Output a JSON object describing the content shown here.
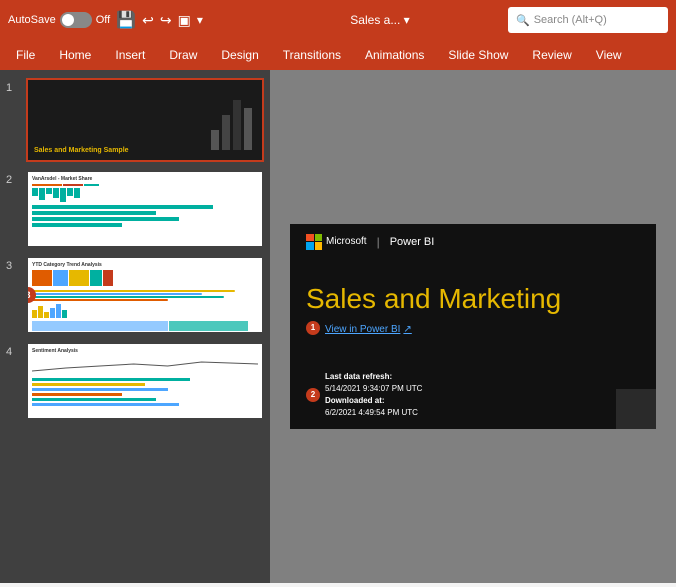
{
  "titlebar": {
    "autosave_label": "AutoSave",
    "autosave_state": "Off",
    "filename": "Sales a...",
    "search_placeholder": "Search (Alt+Q)"
  },
  "tabs": [
    {
      "label": "File",
      "active": false
    },
    {
      "label": "Home",
      "active": false
    },
    {
      "label": "Insert",
      "active": false
    },
    {
      "label": "Draw",
      "active": false
    },
    {
      "label": "Design",
      "active": false
    },
    {
      "label": "Transitions",
      "active": false
    },
    {
      "label": "Animations",
      "active": false
    },
    {
      "label": "Slide Show",
      "active": false
    },
    {
      "label": "Review",
      "active": false
    },
    {
      "label": "View",
      "active": false
    }
  ],
  "slides": [
    {
      "number": "1",
      "title": "Sales and Marketing Sample"
    },
    {
      "number": "2",
      "title": "VanArsdel - Market Share"
    },
    {
      "number": "3",
      "title": "YTD Category Trend Analysis"
    },
    {
      "number": "4",
      "title": "Sentiment Analysis"
    }
  ],
  "current_slide": {
    "top_logo": "Microsoft",
    "top_separator": "|",
    "top_product": "Power BI",
    "main_title": "Sales and Marketing",
    "link_text": "View in Power BI",
    "link_icon": "↗",
    "badge1_number": "1",
    "badge2_number": "2",
    "data_refresh_label": "Last data refresh:",
    "data_refresh_value": "5/14/2021 9:34:07 PM UTC",
    "downloaded_label": "Downloaded at:",
    "downloaded_value": "6/2/2021 4:49:54 PM UTC"
  },
  "slide_badges": {
    "badge3": "3"
  }
}
